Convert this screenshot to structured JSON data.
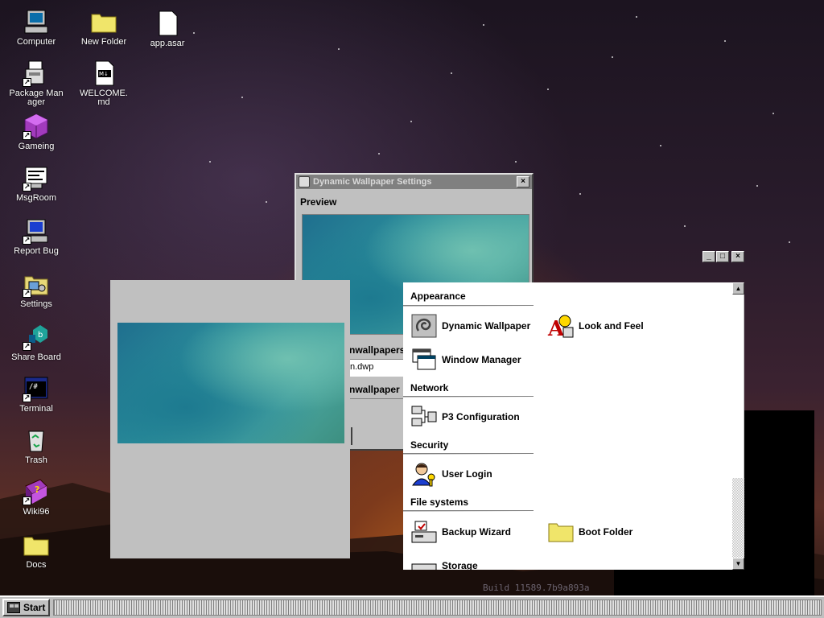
{
  "desktop": {
    "icons": [
      {
        "label": "Computer"
      },
      {
        "label": "Package Manager"
      },
      {
        "label": "Gameing"
      },
      {
        "label": "MsgRoom"
      },
      {
        "label": "Report Bug"
      },
      {
        "label": "Settings"
      },
      {
        "label": "Share Board"
      },
      {
        "label": "Terminal"
      },
      {
        "label": "Trash"
      },
      {
        "label": "Wiki96"
      },
      {
        "label": "Docs"
      },
      {
        "label": "New Folder"
      },
      {
        "label": "WELCOME.md"
      },
      {
        "label": "app.asar"
      }
    ],
    "build_text": "Build 11589.7b9a893a",
    "terminal_glyph": "/#"
  },
  "wallpaper_window": {
    "title": "Dynamic Wallpaper Settings",
    "close_label": "×",
    "preview_label": "Preview",
    "field1_label": "nwallpapers",
    "field1_value": "n.dwp",
    "field2_label": "nwallpaper"
  },
  "settings_window": {
    "min_label": "_",
    "max_label": "□",
    "close_label": "×",
    "sections": {
      "appearance": "Appearance",
      "network": "Network",
      "security": "Security",
      "filesystems": "File systems"
    },
    "items": {
      "dynamic_wallpaper": "Dynamic Wallpaper",
      "look_and_feel": "Look and Feel",
      "window_manager": "Window Manager",
      "p3_configuration": "P3 Configuration",
      "user_login": "User Login",
      "backup_wizard": "Backup Wizard",
      "boot_folder": "Boot Folder",
      "storage": "Storage"
    },
    "scroll_up": "▲",
    "scroll_down": "▼"
  },
  "taskbar": {
    "start_label": "Start"
  }
}
